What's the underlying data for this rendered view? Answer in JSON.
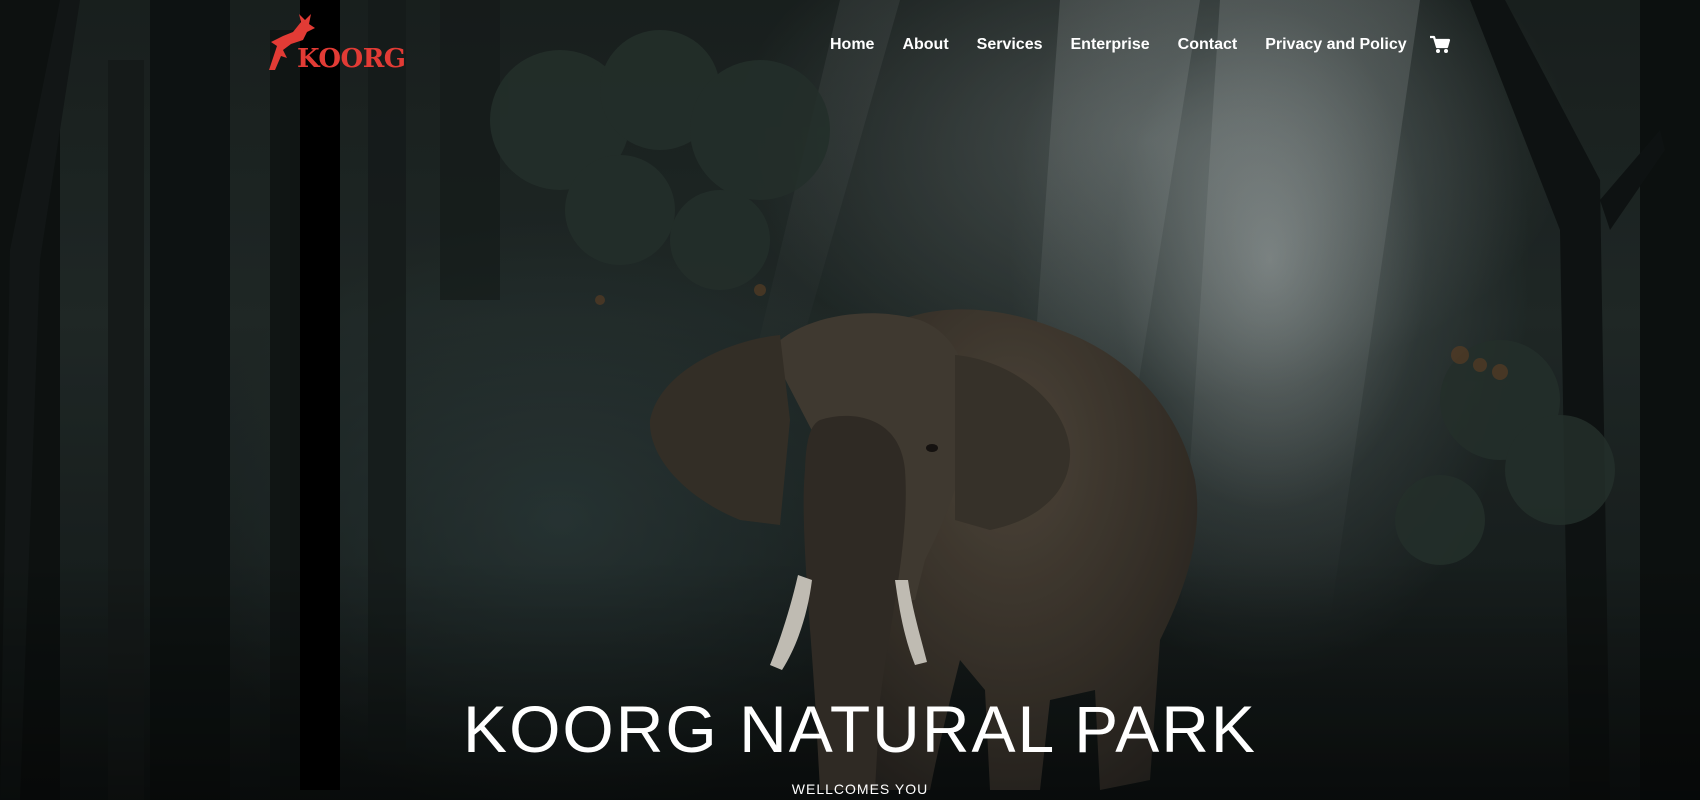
{
  "header": {
    "logo_text": "KOORG",
    "logo_icon": "leaping-deer-icon",
    "brand_color": "#e23b35"
  },
  "nav": {
    "items": [
      {
        "label": "Home"
      },
      {
        "label": "About"
      },
      {
        "label": "Services"
      },
      {
        "label": "Enterprise"
      },
      {
        "label": "Contact"
      },
      {
        "label": "Privacy and Policy"
      }
    ],
    "cart_icon": "shopping-cart-icon"
  },
  "hero": {
    "title": "KOORG NATURAL PARK",
    "subtitle": "WELLCOMES YOU",
    "background_image": "elephant-in-misty-forest"
  }
}
